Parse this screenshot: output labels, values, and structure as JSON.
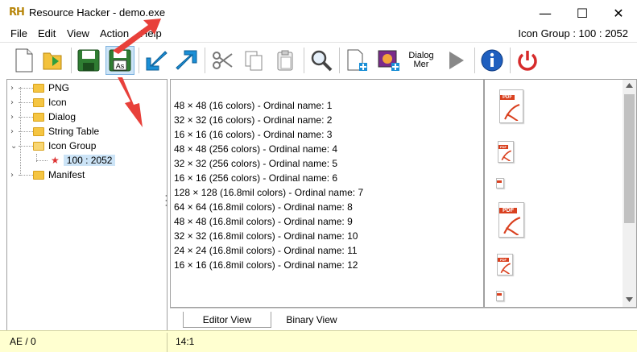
{
  "window": {
    "app_icon_text": "RH",
    "title": "Resource Hacker - demo.exe",
    "minimize": "—",
    "maximize": "☐",
    "close": "✕"
  },
  "menu": {
    "items": [
      "File",
      "Edit",
      "View",
      "Action",
      "Help"
    ],
    "resource_info": "Icon Group : 100 : 2052"
  },
  "toolbar": {
    "dialog_menu_line1": "Dialog",
    "dialog_menu_line2": "Mer"
  },
  "tree": {
    "items": [
      {
        "label": "PNG",
        "expanded": false
      },
      {
        "label": "Icon",
        "expanded": false
      },
      {
        "label": "Dialog",
        "expanded": false
      },
      {
        "label": "String Table",
        "expanded": false
      },
      {
        "label": "Icon Group",
        "expanded": true
      },
      {
        "label": "100 : 2052",
        "selected": true
      },
      {
        "label": "Manifest",
        "expanded": false
      }
    ]
  },
  "editor": {
    "lines": [
      "48 × 48 (16 colors) - Ordinal name: 1",
      "32 × 32 (16 colors) - Ordinal name: 2",
      "16 × 16 (16 colors) - Ordinal name: 3",
      "48 × 48 (256 colors) - Ordinal name: 4",
      "32 × 32 (256 colors) - Ordinal name: 5",
      "16 × 16 (256 colors) - Ordinal name: 6",
      "128 × 128 (16.8mil colors) - Ordinal name: 7",
      "64 × 64 (16.8mil colors) - Ordinal name: 8",
      "48 × 48 (16.8mil colors) - Ordinal name: 9",
      "32 × 32 (16.8mil colors) - Ordinal name: 10",
      "24 × 24 (16.8mil colors) - Ordinal name: 11",
      "16 × 16 (16.8mil colors) - Ordinal name: 12"
    ]
  },
  "preview": {
    "icon_text": "PDF"
  },
  "tabs": [
    {
      "label": "Editor View",
      "active": true
    },
    {
      "label": "Binary View",
      "active": false
    }
  ],
  "status": {
    "left": "AE / 0",
    "right": "14:1"
  },
  "colors": {
    "accent_red": "#e8403a",
    "selection": "#cce4f7",
    "status_bg": "#ffffd0"
  }
}
